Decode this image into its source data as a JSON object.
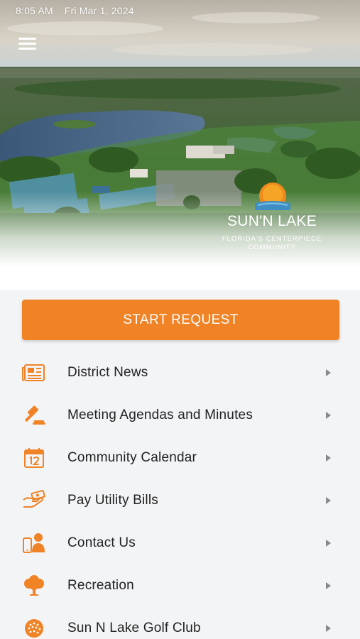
{
  "status_bar": {
    "time": "8:05 AM",
    "date": "Fri Mar 1, 2024"
  },
  "hero": {
    "photo_alt": "aerial-view-of-community-lake-and-tennis-courts",
    "logo": {
      "name": "SUN'N LAKE",
      "tagline_line1": "FLORIDA'S CENTERPIECE",
      "tagline_line2": "COMMUNITY"
    }
  },
  "actions": {
    "start_request": "START REQUEST"
  },
  "menu": {
    "items": [
      {
        "label": "District News",
        "icon": "newspaper-icon"
      },
      {
        "label": "Meeting Agendas and Minutes",
        "icon": "gavel-icon"
      },
      {
        "label": "Community Calendar",
        "icon": "calendar-icon"
      },
      {
        "label": "Pay Utility Bills",
        "icon": "hand-money-icon"
      },
      {
        "label": "Contact Us",
        "icon": "phone-person-icon"
      },
      {
        "label": "Recreation",
        "icon": "tree-icon"
      },
      {
        "label": "Sun N Lake Golf Club",
        "icon": "golf-ball-icon"
      }
    ]
  },
  "colors": {
    "accent": "#f08326",
    "background": "#f3f4f6",
    "text": "#222222",
    "chevron": "#8a8a8a"
  }
}
